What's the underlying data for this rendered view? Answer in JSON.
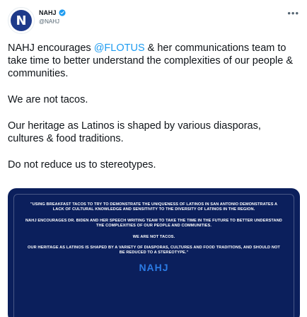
{
  "account": {
    "display_name": "NAHJ",
    "handle": "@NAHJ",
    "avatar_letter": "N",
    "verified": true
  },
  "tweet": {
    "p1_before": "NAHJ encourages ",
    "p1_mention": "@FLOTUS",
    "p1_after": " & her communications team to take time to better understand the complexities of our people & communities.",
    "p2": "We are not tacos.",
    "p3": "Our heritage as Latinos is shaped by various diasporas, cultures & food traditions.",
    "p4": "Do not reduce us to stereotypes."
  },
  "media": {
    "line1": "\"Using breakfast tacos to try to demonstrate the uniqueness of Latinos in San Antonio demonstrates a lack of cultural knowledge and sensitivity to the diversity of Latinos in the region.",
    "line2": "NAHJ encourages Dr. Biden and her speech writing team to take the time in the future to better understand the complexities of our people and communities.",
    "line3": "We are not tacos.",
    "line4": "Our heritage as Latinos is shaped by a variety of diasporas, cultures and food traditions, and should not be reduced to a stereotype.\"",
    "logo": "NAHJ"
  },
  "colors": {
    "link": "#1d9bf0",
    "verified": "#1d9bf0",
    "media_bg": "#0b1f5c",
    "logo": "#2b7be4"
  }
}
